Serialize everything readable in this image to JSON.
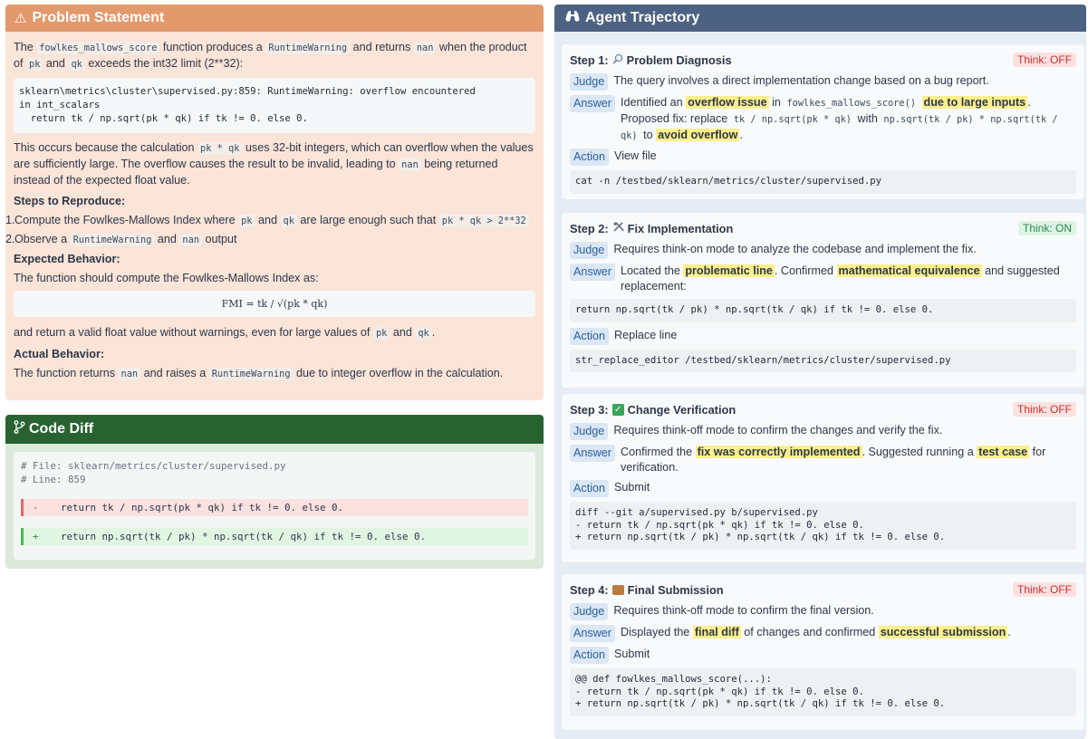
{
  "problem": {
    "title": "Problem Statement",
    "p1_a": "The ",
    "p1_code1": "fowlkes_mallows_score",
    "p1_b": " function produces a ",
    "p1_code2": "RuntimeWarning",
    "p1_c": " and returns ",
    "p1_code3": "nan",
    "p1_d": " when the product of ",
    "p1_code4": "pk",
    "p1_e": " and ",
    "p1_code5": "qk",
    "p1_f": " exceeds the int32 limit (2**32):",
    "error_block": "sklearn\\metrics\\cluster\\supervised.py:859: RuntimeWarning: overflow encountered\nin int_scalars\n  return tk / np.sqrt(pk * qk) if tk != 0. else 0.",
    "p2_a": "This occurs because the calculation ",
    "p2_code1": "pk * qk",
    "p2_b": " uses 32-bit integers, which can overflow when the values are sufficiently large. The overflow causes the result to be invalid, leading to ",
    "p2_code2": "nan",
    "p2_c": " being returned instead of the expected float value.",
    "steps_heading": "Steps to Reproduce:",
    "step1_num": "1.",
    "step1_a": "Compute the Fowlkes-Mallows Index where ",
    "step1_code1": "pk",
    "step1_b": " and ",
    "step1_code2": "qk",
    "step1_c": " are large enough such that ",
    "step1_code3": "pk * qk > 2**32",
    "step2_num": "2.",
    "step2_a": "Observe a ",
    "step2_code1": "RuntimeWarning",
    "step2_b": " and ",
    "step2_code2": "nan",
    "step2_c": " output",
    "expected_heading": "Expected Behavior:",
    "expected_text": "The function should compute the Fowlkes-Mallows Index as:",
    "formula": "FMI = tk / √(pk * qk)",
    "expected_after_a": "and return a valid float value without warnings, even for large values of ",
    "expected_after_code1": "pk",
    "expected_after_b": " and ",
    "expected_after_code2": "qk",
    "expected_after_c": ".",
    "actual_heading": "Actual Behavior:",
    "actual_a": "The function returns ",
    "actual_code1": "nan",
    "actual_b": " and raises a ",
    "actual_code2": "RuntimeWarning",
    "actual_c": " due to integer overflow in the calculation."
  },
  "diff": {
    "title": "Code Diff",
    "comment1": "# File: sklearn/metrics/cluster/supervised.py",
    "comment2": "# Line: 859",
    "minus_sign": "-",
    "minus_line": "return tk / np.sqrt(pk * qk) if tk != 0. else 0.",
    "plus_sign": "+",
    "plus_line": "return np.sqrt(tk / pk) * np.sqrt(tk / qk) if tk != 0. else 0."
  },
  "agent": {
    "title": "Agent Trajectory",
    "labels": {
      "judge": "Judge",
      "answer": "Answer",
      "action": "Action"
    },
    "steps": [
      {
        "prefix": "Step 1:",
        "name": "Problem Diagnosis",
        "icon": "magnifier-icon",
        "badge": "Think: OFF",
        "judge": "The query involves a direct implementation change based on a bug report.",
        "answer_a": "Identified an ",
        "answer_hl1": "overflow issue",
        "answer_b": " in ",
        "answer_code1": "fowlkes_mallows_score()",
        "answer_c": " ",
        "answer_hl2": "due to large inputs",
        "answer_d": ". Proposed fix: replace ",
        "answer_code2": "tk / np.sqrt(pk * qk)",
        "answer_e": " with ",
        "answer_code3": "np.sqrt(tk / pk) * np.sqrt(tk / qk)",
        "answer_f": " to ",
        "answer_hl3": "avoid overflow",
        "answer_g": ".",
        "action": "View file",
        "cmd": "cat -n /testbed/sklearn/metrics/cluster/supervised.py"
      },
      {
        "prefix": "Step 2:",
        "name": "Fix Implementation",
        "icon": "tools-icon",
        "badge": "Think: ON",
        "judge": "Requires think-on mode to analyze the codebase and implement the fix.",
        "answer_a": "Located the ",
        "answer_hl1": "problematic line",
        "answer_b": ". Confirmed ",
        "answer_hl2": "mathematical equivalence",
        "answer_c": " and suggested replacement:",
        "answer_cmd": "return np.sqrt(tk / pk) * np.sqrt(tk / qk) if tk != 0. else 0.",
        "action": "Replace line",
        "cmd": "str_replace_editor /testbed/sklearn/metrics/cluster/supervised.py"
      },
      {
        "prefix": "Step 3:",
        "name": "Change Verification",
        "icon": "check-icon",
        "badge": "Think: OFF",
        "judge": "Requires think-off mode to confirm the changes and verify the fix.",
        "answer_a": "Confirmed the ",
        "answer_hl1": "fix was correctly implemented",
        "answer_b": ". Suggested running a ",
        "answer_hl2": "test case",
        "answer_c": " for verification.",
        "action": "Submit",
        "cmd": "diff --git a/supervised.py b/supervised.py\n- return tk / np.sqrt(pk * qk) if tk != 0. else 0.\n+ return np.sqrt(tk / pk) * np.sqrt(tk / qk) if tk != 0. else 0."
      },
      {
        "prefix": "Step 4:",
        "name": "Final Submission",
        "icon": "package-icon",
        "badge": "Think: OFF",
        "judge": "Requires think-off mode to confirm the final version.",
        "answer_a": "Displayed the ",
        "answer_hl1": "final diff",
        "answer_b": " of changes and confirmed ",
        "answer_hl2": "successful submission",
        "answer_c": ".",
        "action": "Submit",
        "cmd": "@@ def fowlkes_mallows_score(...):\n- return tk / np.sqrt(pk * qk) if tk != 0. else 0.\n+ return np.sqrt(tk / pk) * np.sqrt(tk / qk) if tk != 0. else 0."
      }
    ]
  },
  "colors": {
    "problem_header": "#e2996c",
    "problem_bg": "#fbe4d8",
    "diff_header": "#276230",
    "agent_header": "#4d6282",
    "highlight": "#fbf08c",
    "think_off": "#c53030",
    "think_on": "#2f855a"
  }
}
